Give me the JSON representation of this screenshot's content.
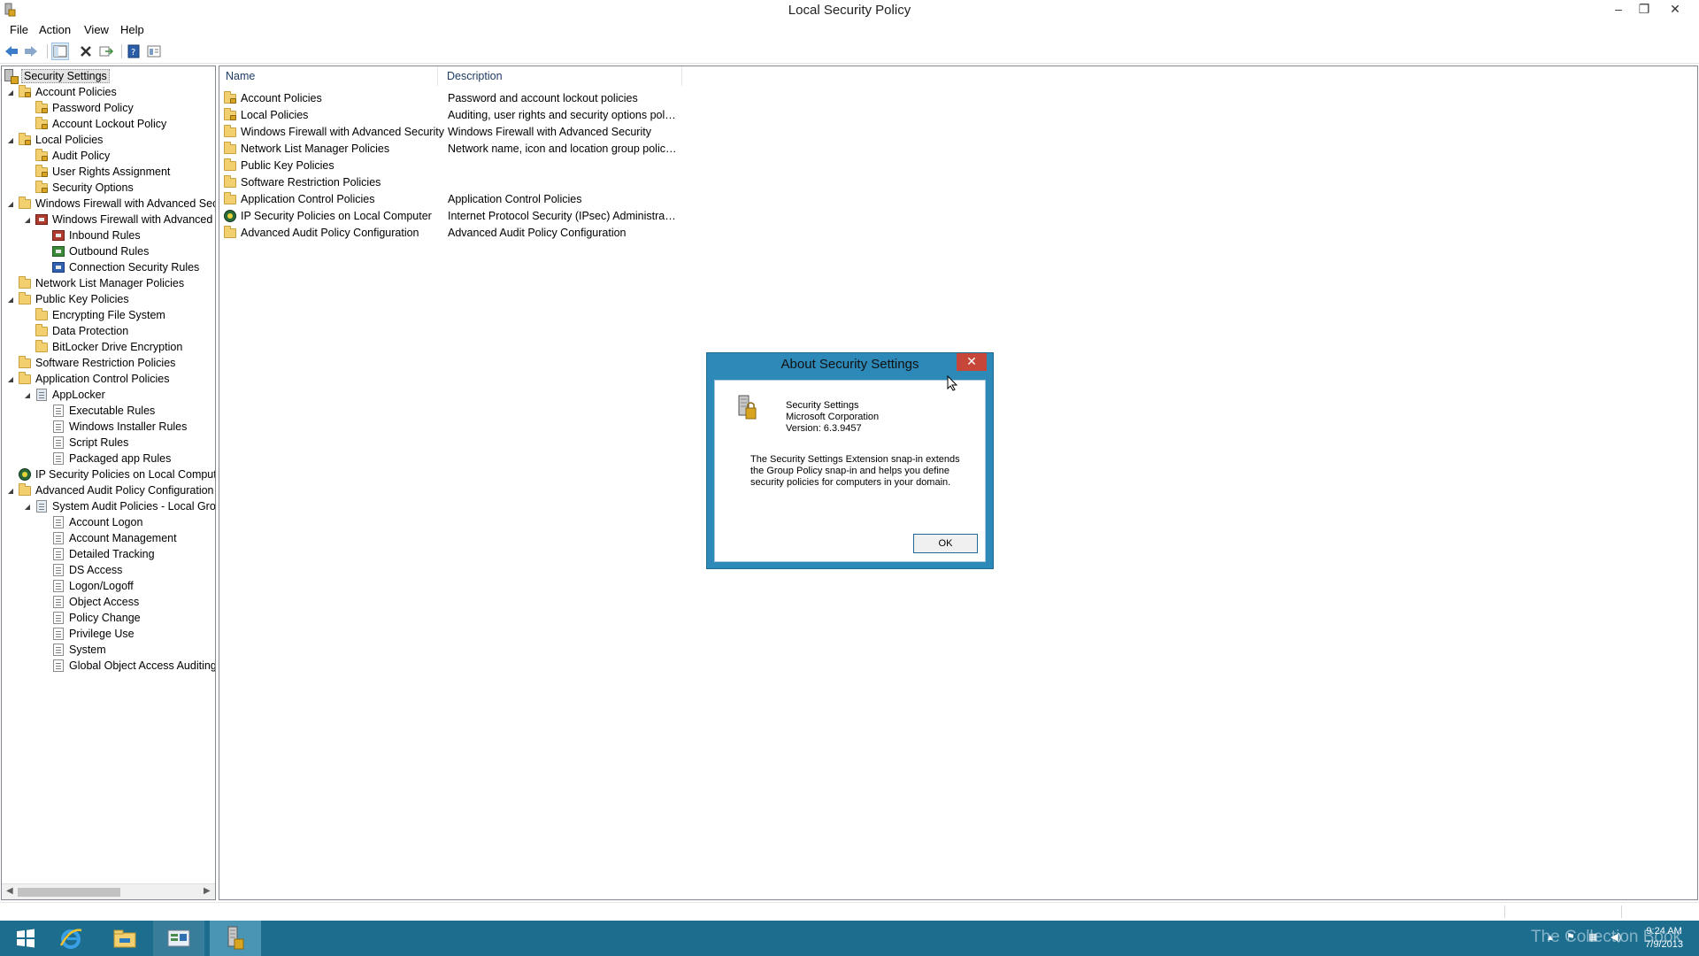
{
  "window": {
    "title": "Local Security Policy",
    "min_glyph": "–",
    "restore_glyph": "❐",
    "close_glyph": "✕"
  },
  "menu": [
    "File",
    "Action",
    "View",
    "Help"
  ],
  "toolbar": {
    "icons": [
      "back-arrow-icon",
      "forward-arrow-icon",
      "show-hide-tree-icon",
      "delete-icon",
      "export-list-icon",
      "help-icon",
      "properties-icon"
    ]
  },
  "tree": {
    "items": [
      {
        "label": "Security Settings",
        "level": 0,
        "icon": "security-settings-icon",
        "expander": ""
      },
      {
        "label": "Account Policies",
        "level": 1,
        "icon": "locked-folder-icon",
        "expander": "◢"
      },
      {
        "label": "Password Policy",
        "level": 2,
        "icon": "locked-folder-icon",
        "expander": ""
      },
      {
        "label": "Account Lockout Policy",
        "level": 2,
        "icon": "locked-folder-icon",
        "expander": ""
      },
      {
        "label": "Local Policies",
        "level": 1,
        "icon": "locked-folder-icon",
        "expander": "◢"
      },
      {
        "label": "Audit Policy",
        "level": 2,
        "icon": "locked-folder-icon",
        "expander": ""
      },
      {
        "label": "User Rights Assignment",
        "level": 2,
        "icon": "locked-folder-icon",
        "expander": ""
      },
      {
        "label": "Security Options",
        "level": 2,
        "icon": "locked-folder-icon",
        "expander": ""
      },
      {
        "label": "Windows Firewall with Advanced Sec",
        "level": 1,
        "icon": "folder-icon",
        "expander": "◢"
      },
      {
        "label": "Windows Firewall with Advanced",
        "level": 2,
        "icon": "firewall-icon",
        "expander": "◢"
      },
      {
        "label": "Inbound Rules",
        "level": 3,
        "icon": "inbound-rules-icon",
        "expander": ""
      },
      {
        "label": "Outbound Rules",
        "level": 3,
        "icon": "outbound-rules-icon",
        "expander": ""
      },
      {
        "label": "Connection Security Rules",
        "level": 3,
        "icon": "connection-security-icon",
        "expander": ""
      },
      {
        "label": "Network List Manager Policies",
        "level": 1,
        "icon": "folder-icon",
        "expander": ""
      },
      {
        "label": "Public Key Policies",
        "level": 1,
        "icon": "folder-icon",
        "expander": "◢"
      },
      {
        "label": "Encrypting File System",
        "level": 2,
        "icon": "folder-icon",
        "expander": ""
      },
      {
        "label": "Data Protection",
        "level": 2,
        "icon": "folder-icon",
        "expander": ""
      },
      {
        "label": "BitLocker Drive Encryption",
        "level": 2,
        "icon": "folder-icon",
        "expander": ""
      },
      {
        "label": "Software Restriction Policies",
        "level": 1,
        "icon": "folder-icon",
        "expander": ""
      },
      {
        "label": "Application Control Policies",
        "level": 1,
        "icon": "folder-icon",
        "expander": "◢"
      },
      {
        "label": "AppLocker",
        "level": 2,
        "icon": "applocker-icon",
        "expander": "◢"
      },
      {
        "label": "Executable Rules",
        "level": 3,
        "icon": "rules-icon",
        "expander": ""
      },
      {
        "label": "Windows Installer Rules",
        "level": 3,
        "icon": "rules-icon",
        "expander": ""
      },
      {
        "label": "Script Rules",
        "level": 3,
        "icon": "rules-icon",
        "expander": ""
      },
      {
        "label": "Packaged app Rules",
        "level": 3,
        "icon": "rules-icon",
        "expander": ""
      },
      {
        "label": "IP Security Policies on Local Compute",
        "level": 1,
        "icon": "ipsec-icon",
        "expander": ""
      },
      {
        "label": "Advanced Audit Policy Configuration",
        "level": 1,
        "icon": "folder-icon",
        "expander": "◢"
      },
      {
        "label": "System Audit Policies - Local Grou",
        "level": 2,
        "icon": "audit-policies-icon",
        "expander": "◢"
      },
      {
        "label": "Account Logon",
        "level": 3,
        "icon": "policy-icon",
        "expander": ""
      },
      {
        "label": "Account Management",
        "level": 3,
        "icon": "policy-icon",
        "expander": ""
      },
      {
        "label": "Detailed Tracking",
        "level": 3,
        "icon": "policy-icon",
        "expander": ""
      },
      {
        "label": "DS Access",
        "level": 3,
        "icon": "policy-icon",
        "expander": ""
      },
      {
        "label": "Logon/Logoff",
        "level": 3,
        "icon": "policy-icon",
        "expander": ""
      },
      {
        "label": "Object Access",
        "level": 3,
        "icon": "policy-icon",
        "expander": ""
      },
      {
        "label": "Policy Change",
        "level": 3,
        "icon": "policy-icon",
        "expander": ""
      },
      {
        "label": "Privilege Use",
        "level": 3,
        "icon": "policy-icon",
        "expander": ""
      },
      {
        "label": "System",
        "level": 3,
        "icon": "policy-icon",
        "expander": ""
      },
      {
        "label": "Global Object Access Auditing",
        "level": 3,
        "icon": "policy-icon",
        "expander": ""
      }
    ],
    "scroll_left": "◀",
    "scroll_right": "▶"
  },
  "list": {
    "columns": [
      "Name",
      "Description"
    ],
    "rows": [
      {
        "name": "Account Policies",
        "description": "Password and account lockout policies",
        "icon": "locked-folder-icon"
      },
      {
        "name": "Local Policies",
        "description": "Auditing, user rights and security options polici...",
        "icon": "locked-folder-icon"
      },
      {
        "name": "Windows Firewall with Advanced Security",
        "description": "Windows Firewall with Advanced Security",
        "icon": "folder-icon"
      },
      {
        "name": "Network List Manager Policies",
        "description": "Network name, icon and location group policies.",
        "icon": "folder-icon"
      },
      {
        "name": "Public Key Policies",
        "description": "",
        "icon": "folder-icon"
      },
      {
        "name": "Software Restriction Policies",
        "description": "",
        "icon": "folder-icon"
      },
      {
        "name": "Application Control Policies",
        "description": "Application Control Policies",
        "icon": "folder-icon"
      },
      {
        "name": "IP Security Policies on Local Computer",
        "description": "Internet Protocol Security (IPsec) Administratio...",
        "icon": "ipsec-icon"
      },
      {
        "name": "Advanced Audit Policy Configuration",
        "description": "Advanced Audit Policy Configuration",
        "icon": "folder-icon"
      }
    ]
  },
  "dialog": {
    "title": "About Security Settings",
    "close_glyph": "✕",
    "product": "Security Settings",
    "company": "Microsoft Corporation",
    "version": "Version: 6.3.9457",
    "description": "The Security Settings Extension snap-in extends the Group Policy snap-in and helps you define security policies for computers in your domain.",
    "ok_label": "OK"
  },
  "taskbar": {
    "items": [
      "start-icon",
      "internet-explorer-icon",
      "file-explorer-icon",
      "server-manager-icon",
      "local-security-policy-icon"
    ],
    "watermark": "The Collection Book",
    "time": "9:24 AM",
    "date": "7/9/2013"
  },
  "colors": {
    "taskbar": "#1d6d8e",
    "dialog_frame": "#2d89b8",
    "close_red": "#c7463a",
    "folder": "#f2cf6f"
  }
}
